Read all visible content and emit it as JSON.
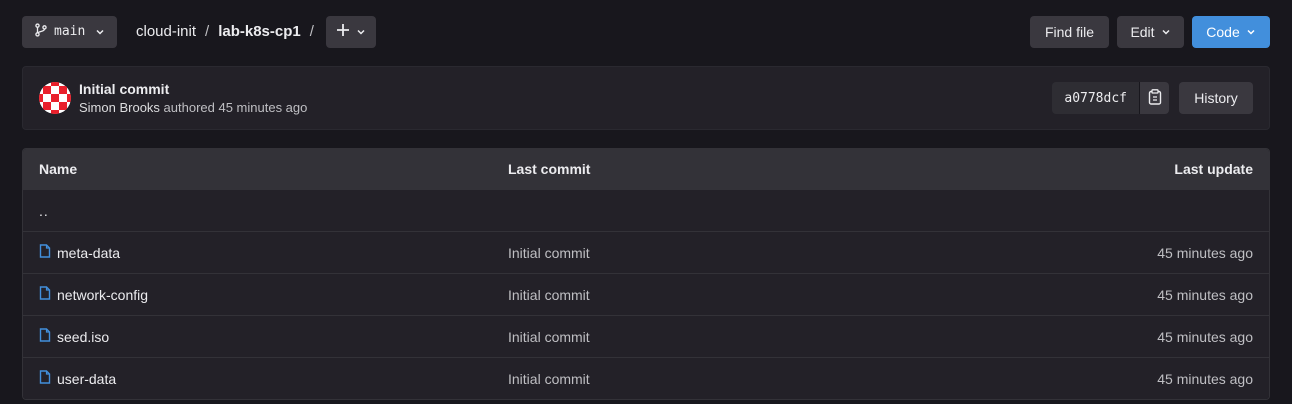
{
  "toolbar": {
    "branch": "main",
    "breadcrumb": [
      "cloud-init",
      "lab-k8s-cp1"
    ],
    "separator": "/",
    "find_file": "Find file",
    "edit": "Edit",
    "code": "Code"
  },
  "last_commit": {
    "title": "Initial commit",
    "author": "Simon Brooks",
    "action": "authored 45 minutes ago",
    "sha": "a0778dcf",
    "history": "History"
  },
  "table": {
    "headers": {
      "name": "Name",
      "last_commit": "Last commit",
      "last_update": "Last update"
    },
    "parent_link": "..",
    "rows": [
      {
        "name": "meta-data",
        "commit": "Initial commit",
        "updated": "45 minutes ago"
      },
      {
        "name": "network-config",
        "commit": "Initial commit",
        "updated": "45 minutes ago"
      },
      {
        "name": "seed.iso",
        "commit": "Initial commit",
        "updated": "45 minutes ago"
      },
      {
        "name": "user-data",
        "commit": "Initial commit",
        "updated": "45 minutes ago"
      }
    ]
  },
  "colors": {
    "background": "#18171d",
    "panel": "#232128",
    "button": "#3a383f",
    "accent": "#428fdc",
    "file_icon": "#428fdc",
    "avatar_red": "#e9202c"
  }
}
